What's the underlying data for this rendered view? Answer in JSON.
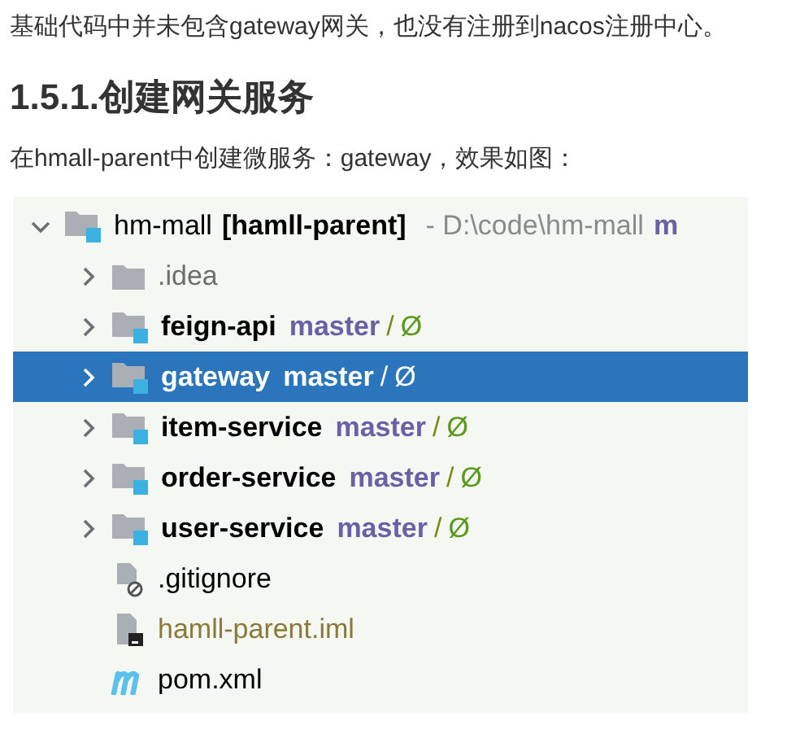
{
  "intro": "基础代码中并未包含gateway网关，也没有注册到nacos注册中心。",
  "heading": "1.5.1.创建网关服务",
  "caption": "在hmall-parent中创建微服务：gateway，效果如图：",
  "tree": {
    "root": {
      "name": "hm-mall",
      "module": "[hamll-parent]",
      "path": "- D:\\code\\hm-mall",
      "branch": "m",
      "kind": "module",
      "expanded": true,
      "selected": false,
      "children": [
        {
          "name": ".idea",
          "kind": "folder",
          "expanded": false,
          "selected": false
        },
        {
          "name": "feign-api",
          "kind": "module",
          "branch": "master",
          "separator": "/",
          "status": "Ø",
          "expanded": false,
          "selected": false
        },
        {
          "name": "gateway",
          "kind": "module",
          "branch": "master",
          "separator": "/",
          "status": "Ø",
          "expanded": false,
          "selected": true
        },
        {
          "name": "item-service",
          "kind": "module",
          "branch": "master",
          "separator": "/",
          "status": "Ø",
          "expanded": false,
          "selected": false
        },
        {
          "name": "order-service",
          "kind": "module",
          "branch": "master",
          "separator": "/",
          "status": "Ø",
          "expanded": false,
          "selected": false
        },
        {
          "name": "user-service",
          "kind": "module",
          "branch": "master",
          "separator": "/",
          "status": "Ø",
          "expanded": false,
          "selected": false
        },
        {
          "name": ".gitignore",
          "kind": "gitignore",
          "selected": false
        },
        {
          "name": "hamll-parent.iml",
          "kind": "iml",
          "selected": false
        },
        {
          "name": "pom.xml",
          "kind": "maven",
          "selected": false
        }
      ]
    }
  }
}
